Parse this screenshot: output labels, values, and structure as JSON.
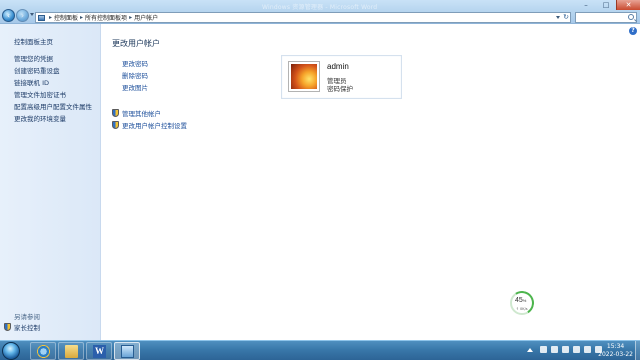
{
  "window": {
    "ghost_title": "Windows 资源管理器 - Microsoft Word"
  },
  "address": {
    "crumbs": [
      "控制面板",
      "所有控制面板项",
      "用户帐户"
    ]
  },
  "search": {
    "placeholder": ""
  },
  "left_pane": {
    "home": "控制面板主页",
    "links": [
      "管理您的凭据",
      "创建密码重设盘",
      "链接联机 ID",
      "管理文件加密证书",
      "配置高级用户配置文件属性",
      "更改我的环境变量"
    ],
    "see_also": "另请参阅",
    "parental_controls": "家长控制"
  },
  "main": {
    "title": "更改用户帐户",
    "actions": [
      "更改密码",
      "删除密码",
      "更改图片"
    ],
    "manage_other": "管理其他帐户",
    "uac_settings": "更改用户帐户控制设置"
  },
  "user": {
    "name": "admin",
    "role": "管理员",
    "password_status": "密码保护"
  },
  "speed_widget": {
    "percent": "45",
    "percent_unit": "%",
    "rate": "↑ 0K/s"
  },
  "clock": {
    "time": "15:34",
    "date": "2022-03-22"
  }
}
